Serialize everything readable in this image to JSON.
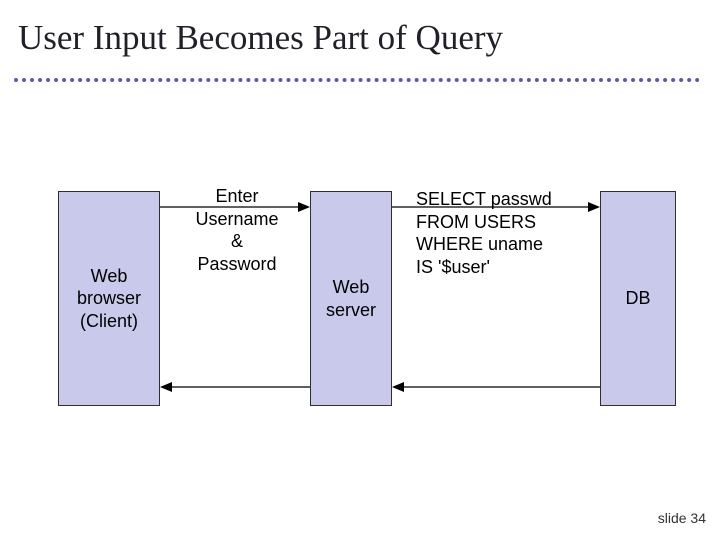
{
  "title": "User Input Becomes Part of Query",
  "boxes": {
    "client": "Web\nbrowser\n(Client)",
    "webserver": "Web\nserver",
    "db": "DB"
  },
  "labels": {
    "enter": "Enter\nUsername\n&\nPassword",
    "query": "SELECT passwd\nFROM USERS\nWHERE uname\nIS '$user'"
  },
  "footer": "slide 34"
}
